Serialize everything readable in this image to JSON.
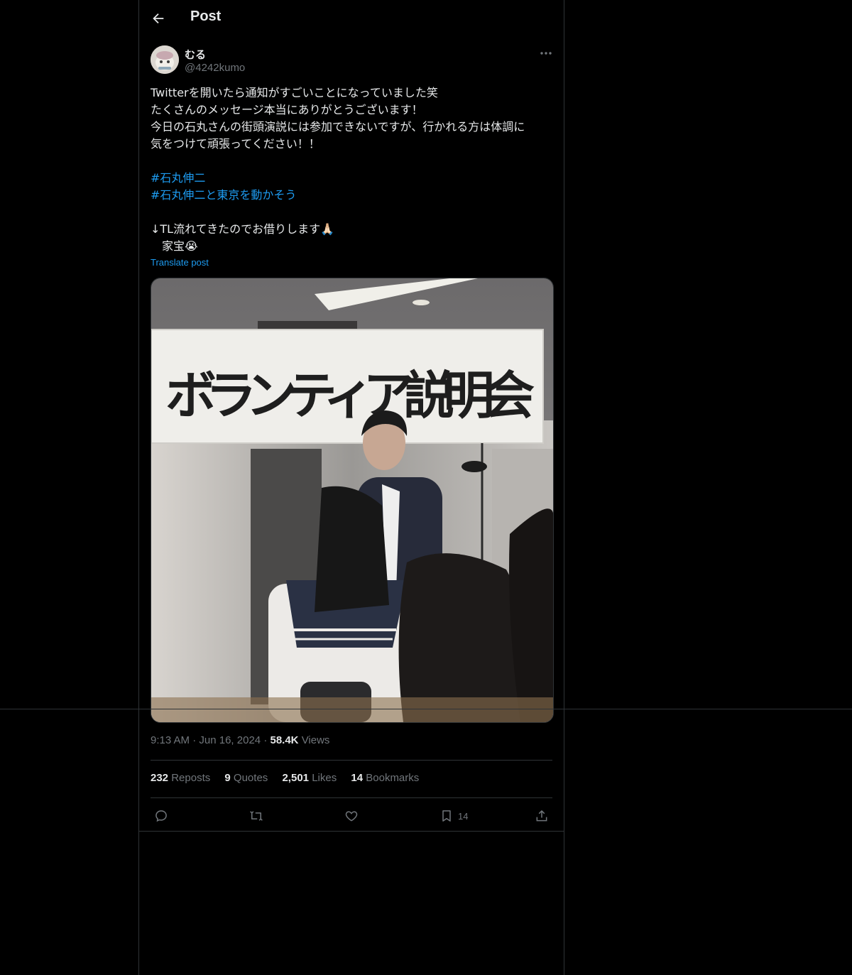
{
  "header": {
    "title": "Post"
  },
  "author": {
    "display_name": "むる",
    "handle": "@4242kumo"
  },
  "post": {
    "lines": [
      "Twitterを開いたら通知がすごいことになっていました笑",
      "たくさんのメッセージ本当にありがとうございます！",
      "今日の石丸さんの街頭演説には参加できないですが、行かれる方は体調に",
      "気をつけて頑張ってください！！"
    ],
    "hashtags": [
      "#石丸伸二",
      "#石丸伸二と東京を動かそう"
    ],
    "footer_lines": [
      "↓TL流れてきたのでお借りします🙏🏻",
      "　家宝😭"
    ],
    "translate_label": "Translate post"
  },
  "media": {
    "banner_text": "ボランティア説明会"
  },
  "meta": {
    "time": "9:13 AM",
    "sep": "·",
    "date": "Jun 16, 2024",
    "views_count": "58.4K",
    "views_label": "Views"
  },
  "stats": {
    "reposts_count": "232",
    "reposts_label": "Reposts",
    "quotes_count": "9",
    "quotes_label": "Quotes",
    "likes_count": "2,501",
    "likes_label": "Likes",
    "bookmarks_count": "14",
    "bookmarks_label": "Bookmarks"
  },
  "actions": {
    "bookmark_count": "14"
  },
  "colors": {
    "background": "#000000",
    "text": "#e7e9ea",
    "muted": "#71767b",
    "accent": "#1d9bf0",
    "border": "#2f3336"
  },
  "icons": [
    "back-arrow-icon",
    "more-icon",
    "reply-icon",
    "repost-icon",
    "like-icon",
    "bookmark-icon",
    "share-icon"
  ]
}
